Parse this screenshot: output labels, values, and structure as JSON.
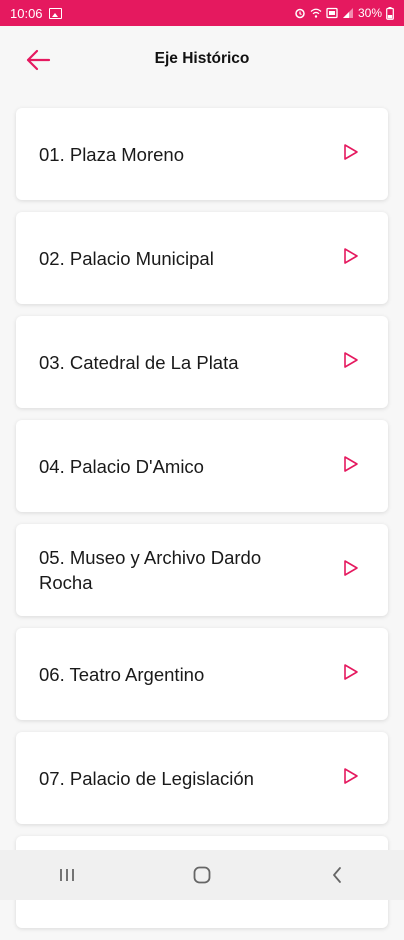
{
  "status_bar": {
    "time": "10:06",
    "battery": "30%",
    "background_color": "#e5195f"
  },
  "header": {
    "title": "Eje Histórico",
    "back_icon": "arrow-left-icon",
    "accent_color": "#e5195f"
  },
  "items": [
    {
      "label": "01. Plaza Moreno"
    },
    {
      "label": "02. Palacio Municipal"
    },
    {
      "label": "03. Catedral de La Plata"
    },
    {
      "label": "04. Palacio D'Amico"
    },
    {
      "label": "05. Museo y Archivo Dardo Rocha"
    },
    {
      "label": "06. Teatro Argentino"
    },
    {
      "label": "07. Palacio de Legislación"
    },
    {
      "label": ""
    }
  ],
  "item_icon": "play-outline-icon",
  "nav_bar": {
    "recents_icon": "recents-icon",
    "home_icon": "home-icon",
    "back_icon": "nav-back-icon"
  }
}
